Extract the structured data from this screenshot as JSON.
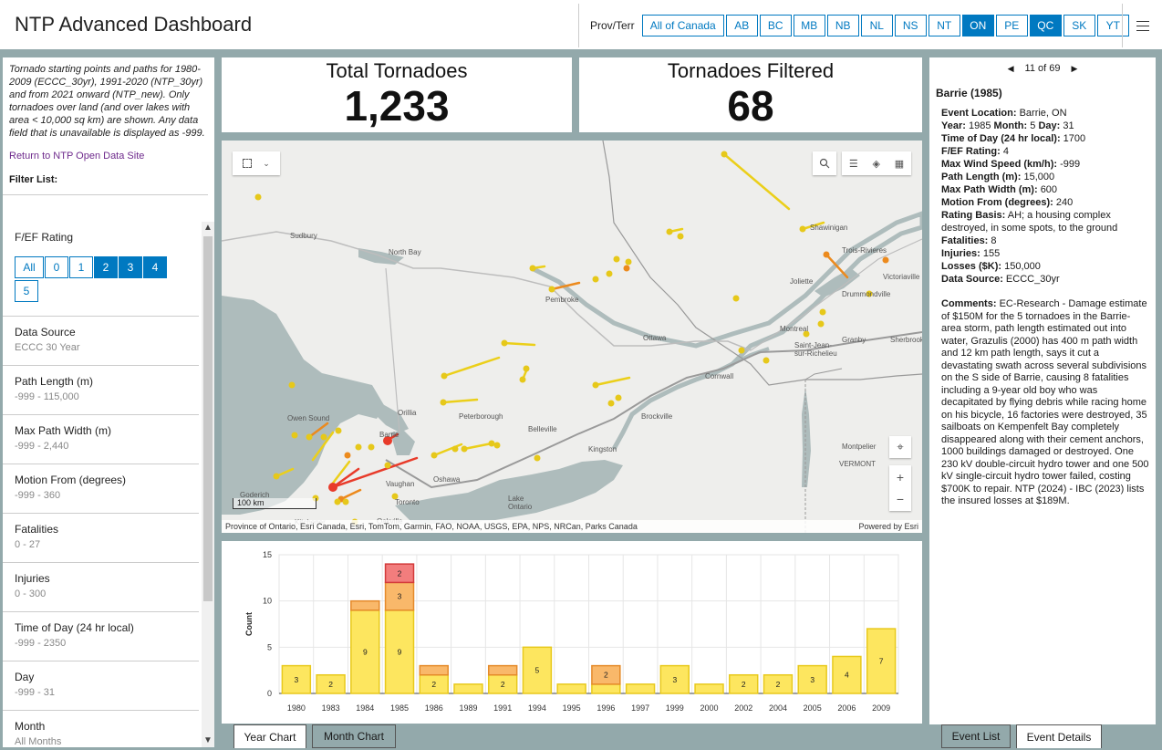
{
  "header": {
    "title": "NTP Advanced Dashboard",
    "prov_label": "Prov/Terr",
    "provinces": [
      {
        "label": "All of Canada",
        "active": false
      },
      {
        "label": "AB",
        "active": false
      },
      {
        "label": "BC",
        "active": false
      },
      {
        "label": "MB",
        "active": false
      },
      {
        "label": "NB",
        "active": false
      },
      {
        "label": "NL",
        "active": false
      },
      {
        "label": "NS",
        "active": false
      },
      {
        "label": "NT",
        "active": false
      },
      {
        "label": "ON",
        "active": true
      },
      {
        "label": "PE",
        "active": false
      },
      {
        "label": "QC",
        "active": true
      },
      {
        "label": "SK",
        "active": false
      },
      {
        "label": "YT",
        "active": false
      }
    ],
    "menu_icon": "hamburger-menu-icon"
  },
  "left_panel": {
    "intro": "Tornado starting points and paths for 1980-2009 (ECCC_30yr), 1991-2020 (NTP_30yr) and from 2021 onward (NTP_new).  Only tornadoes over land (and over lakes with area < 10,000 sq km) are shown. Any data field that is unavailable is displayed as -999.",
    "link": "Return to NTP Open Data Site",
    "filter_list_label": "Filter List:",
    "rating": {
      "title": "F/EF Rating",
      "options": [
        {
          "label": "All",
          "active": false
        },
        {
          "label": "0",
          "active": false
        },
        {
          "label": "1",
          "active": false
        },
        {
          "label": "2",
          "active": true
        },
        {
          "label": "3",
          "active": true
        },
        {
          "label": "4",
          "active": true
        },
        {
          "label": "5",
          "active": false
        }
      ]
    },
    "filters": [
      {
        "title": "Data Source",
        "value": "ECCC 30 Year"
      },
      {
        "title": "Path Length (m)",
        "value": "-999 - 115,000"
      },
      {
        "title": "Max Path Width (m)",
        "value": "-999 - 2,440"
      },
      {
        "title": "Motion From (degrees)",
        "value": "-999 - 360"
      },
      {
        "title": "Fatalities",
        "value": "0 - 27"
      },
      {
        "title": "Injuries",
        "value": "0 - 300"
      },
      {
        "title": "Time of Day (24 hr local)",
        "value": "-999 - 2350"
      },
      {
        "title": "Day",
        "value": "-999 - 31"
      },
      {
        "title": "Month",
        "value": "All Months"
      }
    ]
  },
  "stats": {
    "total_title": "Total Tornadoes",
    "total_value": "1,233",
    "filtered_title": "Tornadoes Filtered",
    "filtered_value": "68"
  },
  "map": {
    "labels": {
      "sudbury": "Sudbury",
      "north_bay": "North Bay",
      "pembroke": "Pembroke",
      "ottawa": "Ottawa",
      "cornwall": "Cornwall",
      "brockville": "Brockville",
      "kingston": "Kingston",
      "belleville": "Belleville",
      "peterborough": "Peterborough",
      "oshawa": "Oshawa",
      "toronto": "Toronto",
      "vaughan": "Vaughan",
      "barrie": "Barrie",
      "orillia": "Orillia",
      "owen_sound": "Owen Sound",
      "goderich": "Goderich",
      "kitchener": "Kitchener",
      "oakville": "Oakville",
      "lake_ontario": "Lake\nOntario",
      "montreal": "Montreal",
      "granby": "Granby",
      "sherbrooke": "Sherbrook",
      "joliette": "Joliette",
      "drummondville": "Drummondville",
      "victoriaville": "Victoriaville",
      "trois_rivieres": "Trois-Rivieres",
      "shawinigan": "Shawinigan",
      "montpelier": "Montpelier",
      "vermont": "VERMONT",
      "saint_jean": "Saint-Jean-\nsur-Richelieu"
    },
    "attribution": "Province of Ontario, Esri Canada, Esri, TomTom, Garmin, FAO, NOAA, USGS, EPA, NPS, NRCan, Parks Canada",
    "powered_by": "Powered by Esri",
    "scale_label": "100 km"
  },
  "chart_data": {
    "type": "bar",
    "stacked": true,
    "ylabel": "Count",
    "ylim": [
      0,
      15
    ],
    "yticks": [
      0,
      5,
      10,
      15
    ],
    "categories": [
      "1980",
      "1983",
      "1984",
      "1985",
      "1986",
      "1989",
      "1991",
      "1994",
      "1995",
      "1996",
      "1997",
      "1999",
      "2000",
      "2002",
      "2004",
      "2005",
      "2006",
      "2009"
    ],
    "series": [
      {
        "color": "#fde65f",
        "values": [
          3,
          2,
          9,
          9,
          2,
          1,
          2,
          5,
          1,
          1,
          1,
          3,
          1,
          2,
          2,
          3,
          4,
          7
        ]
      },
      {
        "color": "#f9b86a",
        "values": [
          0,
          0,
          1,
          3,
          1,
          0,
          1,
          0,
          0,
          2,
          0,
          0,
          0,
          0,
          0,
          0,
          0,
          0
        ]
      },
      {
        "color": "#f27d7d",
        "values": [
          0,
          0,
          0,
          2,
          0,
          0,
          0,
          0,
          0,
          0,
          0,
          0,
          0,
          0,
          0,
          0,
          0,
          0
        ]
      }
    ],
    "bar_labels": [
      [
        "3",
        "2",
        "9",
        "9",
        "2",
        "",
        "2",
        "5",
        "",
        "",
        "",
        "3",
        "",
        "2",
        "2",
        "3",
        "4",
        "7"
      ],
      [
        "",
        "",
        "",
        "3",
        "",
        "",
        "",
        "",
        "",
        "2",
        "",
        "",
        "",
        "",
        "",
        "",
        "",
        ""
      ],
      [
        "",
        "",
        "",
        "2",
        "",
        "",
        "",
        "",
        "",
        "",
        "",
        "",
        "",
        "",
        "",
        "",
        "",
        ""
      ]
    ]
  },
  "chart_tabs": {
    "year": "Year Chart",
    "month": "Month Chart"
  },
  "event": {
    "pager": "11 of 69",
    "title": "Barrie (1985)",
    "location_label": "Event Location:",
    "location": "Barrie, ON",
    "year_label": "Year:",
    "year": "1985",
    "month_label": "Month:",
    "month": "5",
    "day_label": "Day:",
    "day": "31",
    "time_label": "Time of Day (24 hr local):",
    "time": "1700",
    "rating_label": "F/EF Rating:",
    "rating": "4",
    "wind_label": "Max Wind Speed (km/h):",
    "wind": "-999",
    "length_label": "Path Length (m):",
    "length": "15,000",
    "width_label": "Max Path Width (m):",
    "width": "600",
    "motion_label": "Motion From (degrees):",
    "motion": "240",
    "basis_label": "Rating Basis:",
    "basis": "AH; a housing complex destroyed, in some spots, to the ground",
    "fatal_label": "Fatalities:",
    "fatal": "8",
    "injuries_label": "Injuries:",
    "injuries": "155",
    "losses_label": "Losses ($K):",
    "losses": "150,000",
    "source_label": "Data Source:",
    "source": "ECCC_30yr",
    "comments_label": "Comments:",
    "comments": "EC-Research - Damage estimate of $150M for the 5 tornadoes in the Barrie-area storm, path length estimated out into water, Grazulis (2000) has 400 m path width and 12 km path length, says it cut a devastating swath across several subdivisions on the S side of Barrie, causing 8 fatalities including a 9-year old boy who was decapitated by flying debris while racing home on his bicycle, 16 factories were destroyed, 35 sailboats on Kempenfelt Bay completely disappeared along with their cement anchors, 1000 buildings damaged or destroyed. One 230 kV double-circuit hydro tower and one 500 kV single-circuit hydro tower failed, costing $700K to repair. NTP (2024) - IBC (2023) lists the insured losses at $189M."
  },
  "right_tabs": {
    "list": "Event List",
    "details": "Event Details"
  }
}
